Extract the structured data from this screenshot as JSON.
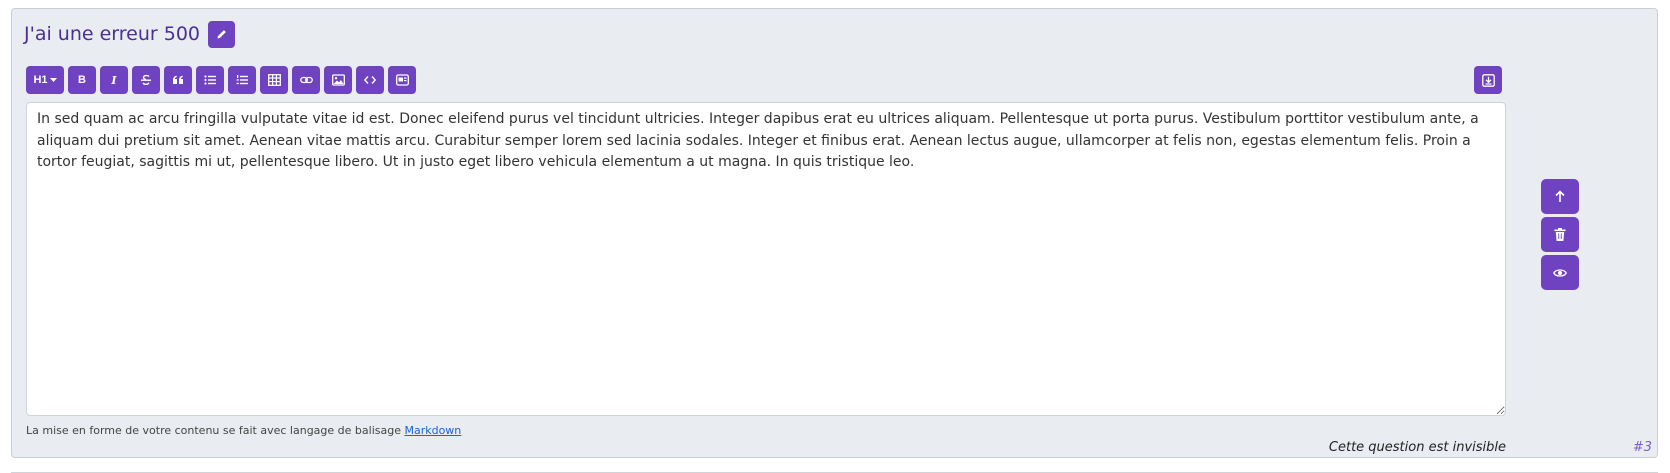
{
  "question": {
    "title": "J'ai une erreur 500",
    "body": "In sed quam ac arcu fringilla vulputate vitae id est. Donec eleifend purus vel tincidunt ultricies. Integer dapibus erat eu ultrices aliquam. Pellentesque ut porta purus. Vestibulum porttitor vestibulum ante, a aliquam dui pretium sit amet. Aenean vitae mattis arcu. Curabitur semper lorem sed lacinia sodales. Integer et finibus erat. Aenean lectus augue, ullamcorper at felis non, egestas elementum felis. Proin a tortor feugiat, sagittis mi ut, pellentesque libero. Ut in justo eget libero vehicula elementum a ut magna. In quis tristique leo.",
    "status": "Cette question est invisible",
    "number": "#3"
  },
  "toolbar": {
    "heading_label": "H1",
    "bold_label": "B",
    "italic_label": "I"
  },
  "help": {
    "text": "La mise en forme de votre contenu se fait avec langage de balisage ",
    "link": "Markdown"
  },
  "icons": {
    "edit": "pencil-icon",
    "strikethrough": "strikethrough-icon",
    "quote": "quote-icon",
    "unordered_list": "list-ul-icon",
    "ordered_list": "list-ol-icon",
    "table": "table-icon",
    "link": "link-icon",
    "image": "image-icon",
    "code": "code-icon",
    "embed": "embed-icon",
    "save": "save-icon",
    "move_up": "arrow-up-icon",
    "delete": "trash-icon",
    "visibility": "eye-icon"
  },
  "colors": {
    "accent": "#6f42c1",
    "title": "#4b2f97",
    "card_background": "#e9ecf0",
    "link": "#1a62d6"
  }
}
